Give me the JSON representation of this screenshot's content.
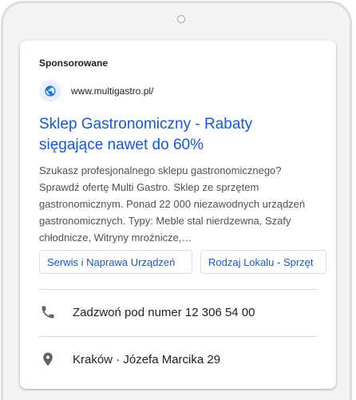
{
  "ad": {
    "sponsored_label": "Sponsorowane",
    "url": "www.multigastro.pl/",
    "headline_line1": "Sklep Gastronomiczny - Rabaty",
    "headline_line2": "sięgające nawet do 60%",
    "description": "Szukasz profesjonalnego sklepu gastronomicznego? Sprawdź ofertę Multi Gastro. Sklep ze sprzętem gastronomicznym. Ponad 22 000 niezawodnych urządzeń gastronomicznych. Typy: Meble stal nierdzewna, Szafy chłodnicze, Witryny mroźnicze,…",
    "sitelinks": [
      {
        "label": "Serwis i Naprawa Urządzeń"
      },
      {
        "label": "Rodzaj Lokalu - Sprzęt"
      }
    ],
    "call": {
      "label": "Zadzwoń pod numer 12 306 54 00",
      "icon": "phone-icon"
    },
    "location": {
      "label": "Kraków · Józefa Marcika 29",
      "icon": "location-pin-icon"
    },
    "favicon_icon": "globe-icon"
  },
  "colors": {
    "headline": "#1558d6",
    "sitelink": "#1a57c2",
    "text": "#202124",
    "muted": "#4d5156"
  }
}
